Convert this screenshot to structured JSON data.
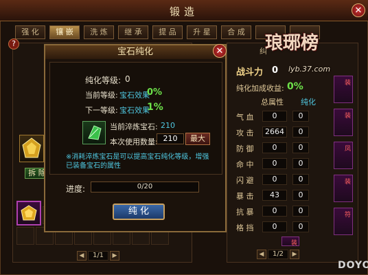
{
  "window": {
    "title": "锻造"
  },
  "tabs": [
    {
      "label": "强 化",
      "active": false
    },
    {
      "label": "镶 嵌",
      "active": true
    },
    {
      "label": "洗 炼",
      "active": false
    },
    {
      "label": "继 承",
      "active": false
    },
    {
      "label": "提 品",
      "active": false
    },
    {
      "label": "升 星",
      "active": false
    },
    {
      "label": "合 成",
      "active": false
    },
    {
      "label": "",
      "active": false
    },
    {
      "label": "",
      "active": false
    }
  ],
  "left_panel": {
    "help_label": "?",
    "button_label": "拆 除",
    "pager": {
      "text": "1/1",
      "prev": "◀",
      "next": "▶"
    }
  },
  "dialog": {
    "title": "宝石纯化",
    "level_label": "纯化等级:",
    "level_value": "0",
    "current_label": "当前等级:",
    "current_text": "宝石效果",
    "current_value": "0%",
    "next_label": "下一等级:",
    "next_text": "宝石效果",
    "next_value": "1%",
    "current_gem_label": "当前淬炼宝石:",
    "current_gem_value": "210",
    "use_count_label": "本次使用数量:",
    "use_count_value": "210",
    "max_button": "最大",
    "note": "※消耗淬炼宝石是可以提高宝石纯化等级，增强已装备宝石的属性",
    "progress_label": "进度:",
    "progress_text": "0/20",
    "progress_fraction": 0,
    "confirm_button": "纯 化"
  },
  "right_panel": {
    "header_partial": "纠",
    "power_label": "战斗力",
    "power_value": "0",
    "purify_label": "纯化加成收益:",
    "purify_value": "0%",
    "col_total": "总属性",
    "col_purify": "纯化",
    "stats": [
      {
        "name": "气 血",
        "total": "0",
        "purify": "0"
      },
      {
        "name": "攻 击",
        "total": "2664",
        "purify": "0"
      },
      {
        "name": "防 御",
        "total": "0",
        "purify": "0"
      },
      {
        "name": "命 中",
        "total": "0",
        "purify": "0"
      },
      {
        "name": "闪 避",
        "total": "0",
        "purify": "0"
      },
      {
        "name": "暴 击",
        "total": "43",
        "purify": "0"
      },
      {
        "name": "抗 暴",
        "total": "0",
        "purify": "0"
      },
      {
        "name": "格 挡",
        "total": "0",
        "purify": "0"
      }
    ],
    "equip_tags": [
      "装",
      "装",
      "凤",
      "装",
      "符",
      "装"
    ],
    "pager": {
      "text": "1/2",
      "prev": "◀",
      "next": "▶"
    }
  },
  "logo": {
    "text": "琅琊榜",
    "subtext": "lyb.37.com"
  },
  "watermark": "DOYO",
  "colors": {
    "green": "#6de14a",
    "cyan": "#4fc7e0",
    "gold": "#f2d48a",
    "dialog_border": "#8a6a3a"
  }
}
